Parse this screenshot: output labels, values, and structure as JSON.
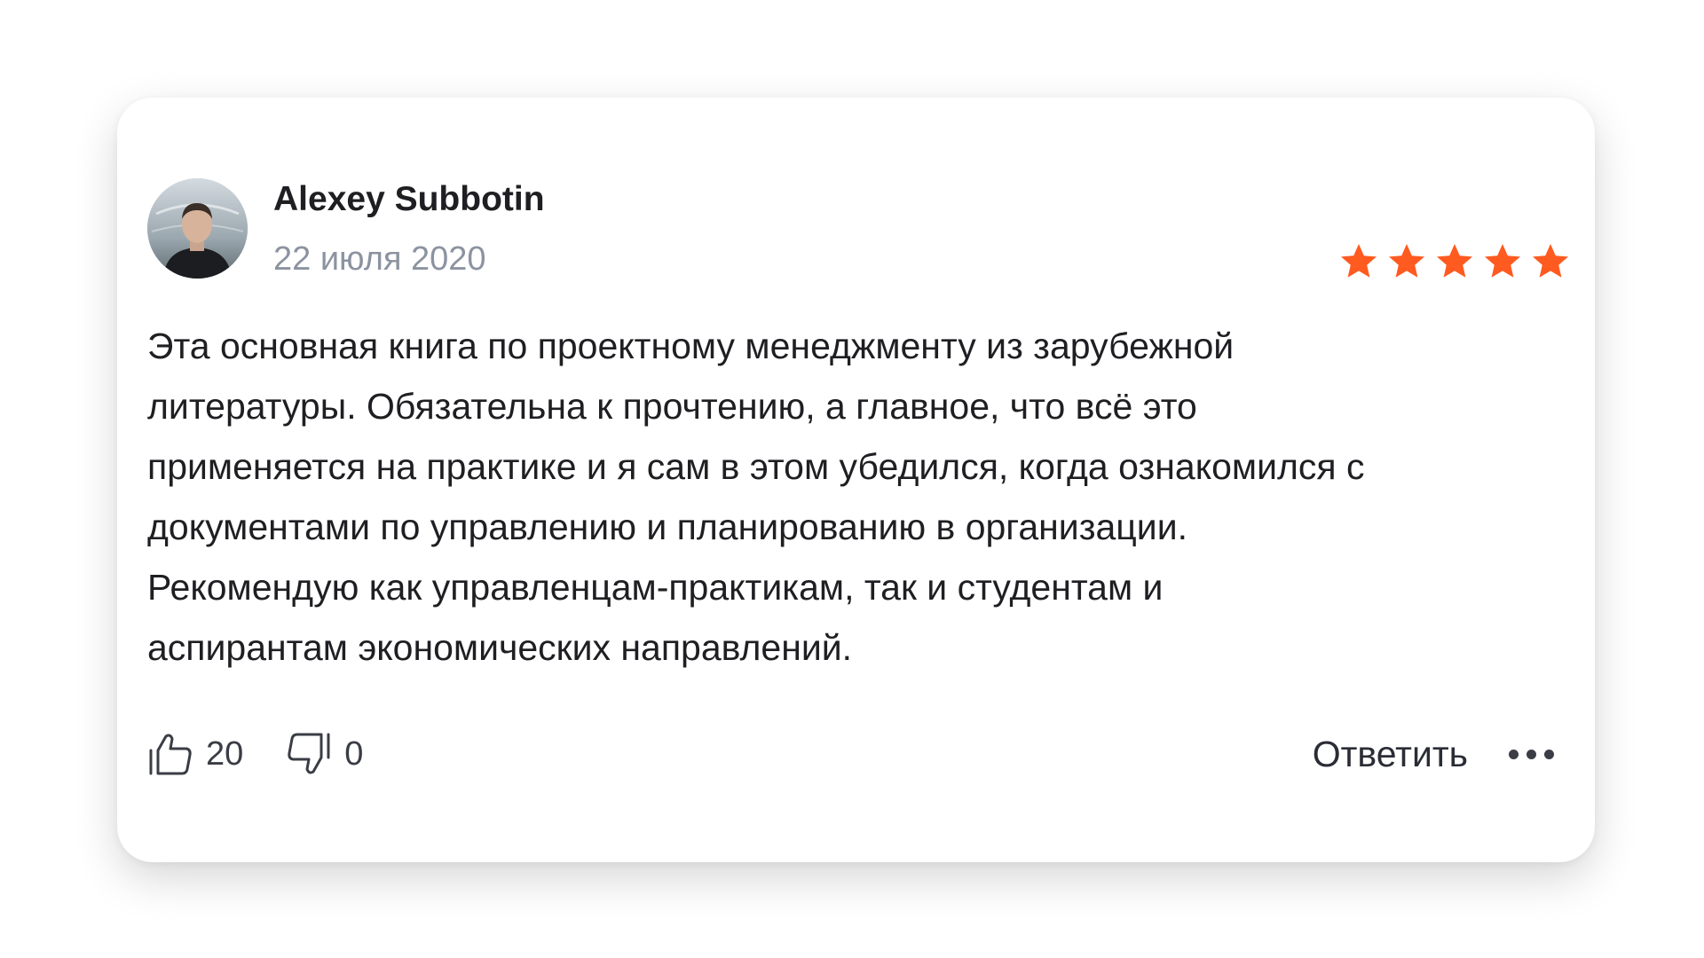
{
  "review": {
    "author": "Alexey Subbotin",
    "date": "22 июля 2020",
    "rating": 5,
    "rating_max": 5,
    "text": "Эта основная книга по проектному менеджменту из зарубежной\nлитературы. Обязательна к прочтению, а главное, что всё это\nприменяется на практике и я сам в этом убедился, когда ознакомился с\nдокументами по управлению и планированию в организации.\nРекомендую как управленцам-практикам, так и студентам и\nаспирантам экономических направлений."
  },
  "actions": {
    "likes": "20",
    "dislikes": "0",
    "reply_label": "Ответить"
  },
  "icons": {
    "like": "thumbs-up-icon",
    "dislike": "thumbs-down-icon",
    "more": "more-dots-icon",
    "star": "star-icon"
  },
  "colors": {
    "star": "#ff5a1f",
    "text": "#1f1f23",
    "muted": "#8c93a0"
  }
}
